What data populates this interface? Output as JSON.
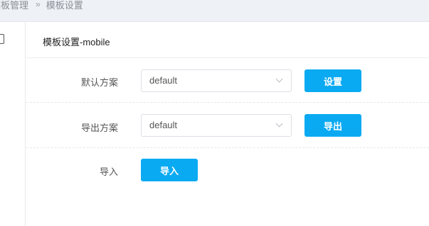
{
  "breadcrumb": {
    "items": [
      "模板管理",
      "模板设置"
    ],
    "separator": "»"
  },
  "page": {
    "title": "模板设置-mobile"
  },
  "form": {
    "default_scheme": {
      "label": "默认方案",
      "value": "default",
      "button": "设置"
    },
    "export_scheme": {
      "label": "导出方案",
      "value": "default",
      "button": "导出"
    },
    "import": {
      "label": "导入",
      "button": "导入"
    }
  },
  "icons": {
    "rail": "mobile-device-icon",
    "select": "chevron-down-icon"
  },
  "colors": {
    "primary_button": "#0aaaf2",
    "breadcrumb_bg": "#eef1f5"
  }
}
